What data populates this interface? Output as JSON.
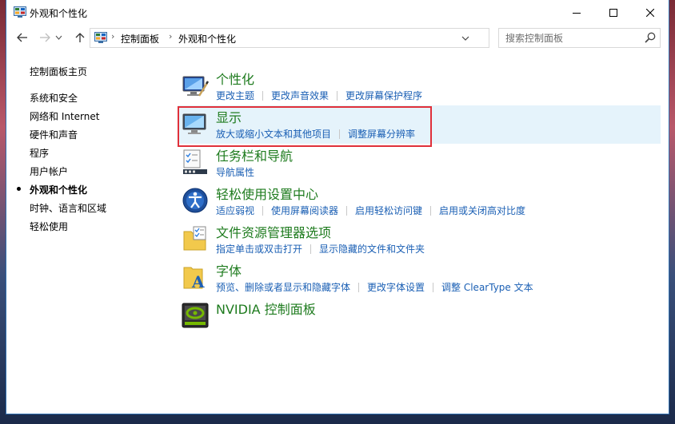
{
  "window": {
    "title": "外观和个性化",
    "controls": {
      "minimize": "minimize",
      "maximize": "maximize",
      "close": "close"
    }
  },
  "address": {
    "crumbs": [
      "控制面板",
      "外观和个性化"
    ]
  },
  "search": {
    "placeholder": "搜索控制面板"
  },
  "left_nav": {
    "home": "控制面板主页",
    "items": [
      {
        "label": "系统和安全"
      },
      {
        "label": "网络和 Internet"
      },
      {
        "label": "硬件和声音"
      },
      {
        "label": "程序"
      },
      {
        "label": "用户帐户"
      },
      {
        "label": "外观和个性化",
        "active": true
      },
      {
        "label": "时钟、语言和区域"
      },
      {
        "label": "轻松使用"
      }
    ]
  },
  "categories": [
    {
      "title": "个性化",
      "icon": "personalization-icon",
      "links": [
        "更改主题",
        "更改声音效果",
        "更改屏幕保护程序"
      ]
    },
    {
      "title": "显示",
      "icon": "display-icon",
      "links": [
        "放大或缩小文本和其他项目",
        "调整屏幕分辨率"
      ],
      "highlighted": true
    },
    {
      "title": "任务栏和导航",
      "icon": "taskbar-icon",
      "links": [
        "导航属性"
      ]
    },
    {
      "title": "轻松使用设置中心",
      "icon": "ease-of-access-icon",
      "links": [
        "适应弱视",
        "使用屏幕阅读器",
        "启用轻松访问键",
        "启用或关闭高对比度"
      ]
    },
    {
      "title": "文件资源管理器选项",
      "icon": "folder-options-icon",
      "links": [
        "指定单击或双击打开",
        "显示隐藏的文件和文件夹"
      ]
    },
    {
      "title": "字体",
      "icon": "fonts-icon",
      "links": [
        "预览、删除或者显示和隐藏字体",
        "更改字体设置",
        "调整 ClearType 文本"
      ]
    },
    {
      "title": "NVIDIA 控制面板",
      "icon": "nvidia-icon",
      "links": []
    }
  ],
  "colors": {
    "category_title": "#1e7b1e",
    "link": "#1a5fb4",
    "highlight_bg": "#e5f3fb",
    "annotation_box": "#e0303a"
  }
}
